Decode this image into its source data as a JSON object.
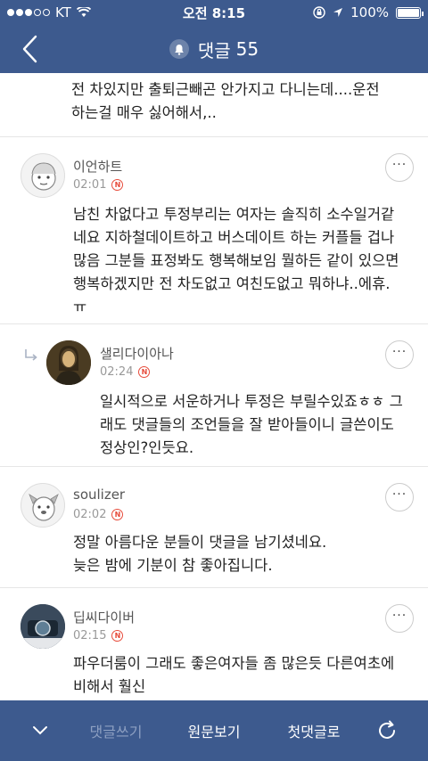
{
  "status_bar": {
    "carrier": "KT",
    "time": "오전 8:15",
    "battery": "100%"
  },
  "header": {
    "title": "댓글",
    "count": "55"
  },
  "previous_comment_tail": "전 차있지만 출퇴근빼곤 안가지고 다니는데....운전하는걸 매우 싫어해서,..",
  "comments": [
    {
      "author": "이언하트",
      "time": "02:01",
      "text": "남친 차없다고 투정부리는 여자는 솔직히 소수일거같네요 지하철데이트하고 버스데이트 하는 커플들 겁나많음 그분들 표정봐도 행복해보임 뭘하든 같이 있으면 행복하겠지만 전 차도없고 여친도없고 뭐하냐..에휴. ㅠ",
      "reply": false
    },
    {
      "author": "샐리다이아나",
      "time": "02:24",
      "text": "일시적으로 서운하거나 투정은 부릴수있죠ㅎㅎ 그래도 댓글들의 조언들을 잘 받아들이니 글쓴이도 정상인?인듯요.",
      "reply": true
    },
    {
      "author": "soulizer",
      "time": "02:02",
      "text": "정말 아름다운 분들이 댓글을 남기셨네요.\n늦은 밤에 기분이 참 좋아집니다.",
      "reply": false
    },
    {
      "author": "딥씨다이버",
      "time": "02:15",
      "text": "파우더룸이 그래도 좋은여자들 좀 많은듯 다른여초에 비해서 훨신",
      "reply": false
    }
  ],
  "new_badge": "N",
  "bottom_bar": {
    "write": "댓글쓰기",
    "view_original": "원문보기",
    "first_comment": "첫댓글로"
  },
  "colors": {
    "header_bg": "#3d5a8e",
    "new_badge": "#e74c3c"
  }
}
